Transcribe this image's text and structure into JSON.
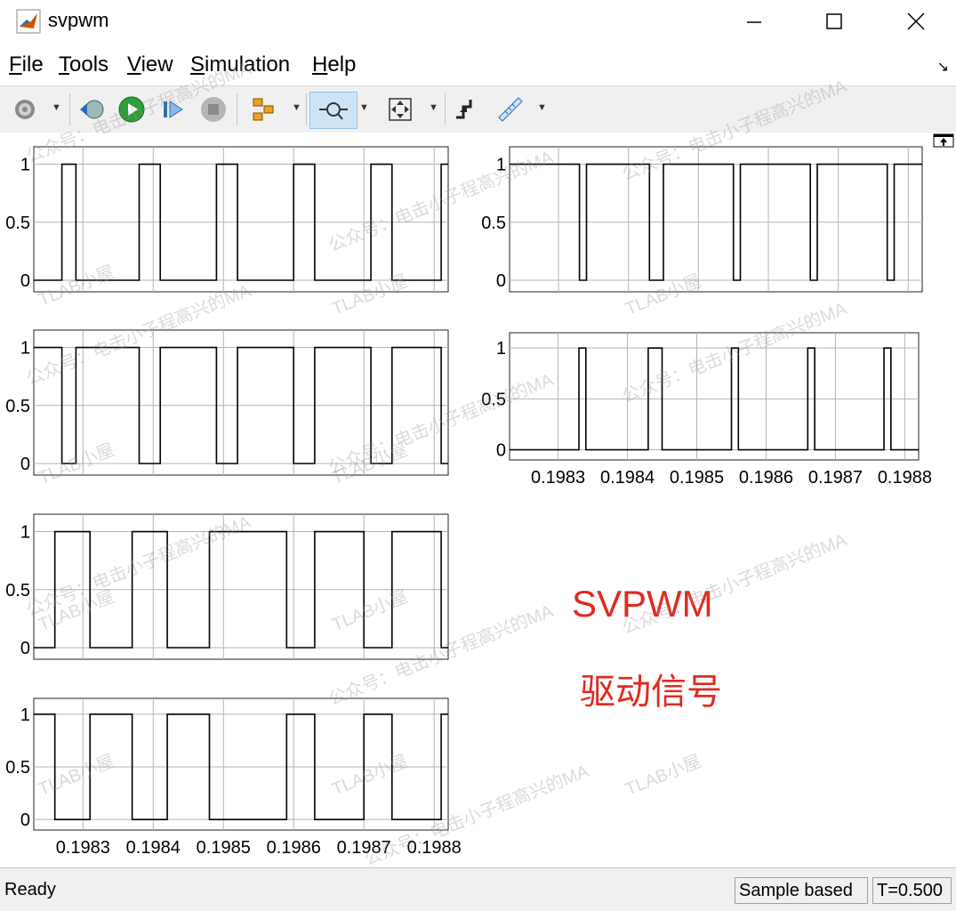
{
  "window": {
    "title": "svpwm"
  },
  "menu": [
    {
      "label": "File",
      "mnemonic": "F",
      "rest": "ile"
    },
    {
      "label": "Tools",
      "mnemonic": "T",
      "rest": "ools"
    },
    {
      "label": "View",
      "mnemonic": "V",
      "rest": "iew"
    },
    {
      "label": "Simulation",
      "mnemonic": "S",
      "rest": "imulation"
    },
    {
      "label": "Help",
      "mnemonic": "H",
      "rest": "elp"
    }
  ],
  "toolbar": [
    "settings-icon",
    "restore-icon",
    "run-icon",
    "step-forward-icon",
    "stop-icon",
    "highlight-icon",
    "zoom-icon",
    "fit-to-view-icon",
    "triggers-icon",
    "measure-icon"
  ],
  "annotation": {
    "title": "SVPWM",
    "subtitle": "驱动信号"
  },
  "watermark": {
    "line1": "公众号：电击小子程高兴的MA",
    "line2": "TLAB小屋"
  },
  "status": {
    "left": "Ready",
    "mode": "Sample based",
    "time": "T=0.500"
  },
  "colors": {
    "signal": "#000000",
    "grid": "#b4b4b4",
    "annotation": "#e02b20",
    "toolbar_bg": "#f0f0f0"
  },
  "chart_data": [
    {
      "type": "line",
      "title": "",
      "xlabel": "",
      "ylabel": "",
      "xlim": [
        0.19823,
        0.19882
      ],
      "ylim": [
        -0.1,
        1.15
      ],
      "xticks": [
        "0.1983",
        "0.1984",
        "0.1985",
        "0.1986",
        "0.1987",
        "0.1988"
      ],
      "yticks": [
        "0",
        "0.5",
        "1"
      ],
      "grid": true,
      "show_xtick_labels": false,
      "series": [
        {
          "x": [
            0.19823,
            0.19827,
            0.19827,
            0.19829,
            0.19829,
            0.19838,
            0.19838,
            0.19841,
            0.19841,
            0.19849,
            0.19849,
            0.19852,
            0.19852,
            0.1986,
            0.1986,
            0.19863,
            0.19863,
            0.19871,
            0.19871,
            0.19874,
            0.19874,
            0.19881,
            0.19881,
            0.19882
          ],
          "y": [
            0,
            0,
            1,
            1,
            0,
            0,
            1,
            1,
            0,
            0,
            1,
            1,
            0,
            0,
            1,
            1,
            0,
            0,
            1,
            1,
            0,
            0,
            1,
            1
          ]
        }
      ]
    },
    {
      "type": "line",
      "title": "",
      "xlabel": "",
      "ylabel": "",
      "xlim": [
        0.19823,
        0.19882
      ],
      "ylim": [
        -0.1,
        1.15
      ],
      "xticks": [
        "0.1983",
        "0.1984",
        "0.1985",
        "0.1986",
        "0.1987",
        "0.1988"
      ],
      "yticks": [
        "0",
        "0.5",
        "1"
      ],
      "grid": true,
      "show_xtick_labels": false,
      "series": [
        {
          "x": [
            0.19823,
            0.19833,
            0.19833,
            0.19834,
            0.19834,
            0.19843,
            0.19843,
            0.19845,
            0.19845,
            0.19855,
            0.19855,
            0.19856,
            0.19856,
            0.19866,
            0.19866,
            0.19867,
            0.19867,
            0.19877,
            0.19877,
            0.19878,
            0.19878,
            0.19882
          ],
          "y": [
            1,
            1,
            0,
            0,
            1,
            1,
            0,
            0,
            1,
            1,
            0,
            0,
            1,
            1,
            0,
            0,
            1,
            1,
            0,
            0,
            1,
            1
          ]
        }
      ]
    },
    {
      "type": "line",
      "title": "",
      "xlabel": "",
      "ylabel": "",
      "xlim": [
        0.19823,
        0.19882
      ],
      "ylim": [
        -0.1,
        1.15
      ],
      "xticks": [
        "0.1983",
        "0.1984",
        "0.1985",
        "0.1986",
        "0.1987",
        "0.1988"
      ],
      "yticks": [
        "0",
        "0.5",
        "1"
      ],
      "grid": true,
      "show_xtick_labels": false,
      "series": [
        {
          "x": [
            0.19823,
            0.19827,
            0.19827,
            0.19829,
            0.19829,
            0.19838,
            0.19838,
            0.19841,
            0.19841,
            0.19849,
            0.19849,
            0.19852,
            0.19852,
            0.1986,
            0.1986,
            0.19863,
            0.19863,
            0.19871,
            0.19871,
            0.19874,
            0.19874,
            0.19881,
            0.19881,
            0.19882
          ],
          "y": [
            1,
            1,
            0,
            0,
            1,
            1,
            0,
            0,
            1,
            1,
            0,
            0,
            1,
            1,
            0,
            0,
            1,
            1,
            0,
            0,
            1,
            1,
            0,
            0
          ]
        }
      ]
    },
    {
      "type": "line",
      "title": "",
      "xlabel": "",
      "ylabel": "",
      "xlim": [
        0.19823,
        0.19882
      ],
      "ylim": [
        -0.1,
        1.15
      ],
      "xticks": [
        "0.1983",
        "0.1984",
        "0.1985",
        "0.1986",
        "0.1987",
        "0.1988"
      ],
      "yticks": [
        "0",
        "0.5",
        "1"
      ],
      "grid": true,
      "show_xtick_labels": true,
      "series": [
        {
          "x": [
            0.19823,
            0.19833,
            0.19833,
            0.19834,
            0.19834,
            0.19843,
            0.19843,
            0.19845,
            0.19845,
            0.19855,
            0.19855,
            0.19856,
            0.19856,
            0.19866,
            0.19866,
            0.19867,
            0.19867,
            0.19877,
            0.19877,
            0.19878,
            0.19878,
            0.19882
          ],
          "y": [
            0,
            0,
            1,
            1,
            0,
            0,
            1,
            1,
            0,
            0,
            1,
            1,
            0,
            0,
            1,
            1,
            0,
            0,
            1,
            1,
            0,
            0
          ]
        }
      ]
    },
    {
      "type": "line",
      "title": "",
      "xlabel": "",
      "ylabel": "",
      "xlim": [
        0.19823,
        0.19882
      ],
      "ylim": [
        -0.1,
        1.15
      ],
      "xticks": [
        "0.1983",
        "0.1984",
        "0.1985",
        "0.1986",
        "0.1987",
        "0.1988"
      ],
      "yticks": [
        "0",
        "0.5",
        "1"
      ],
      "grid": true,
      "show_xtick_labels": false,
      "series": [
        {
          "x": [
            0.19823,
            0.19826,
            0.19826,
            0.19831,
            0.19831,
            0.19837,
            0.19837,
            0.19842,
            0.19842,
            0.19848,
            0.19848,
            0.19859,
            0.19859,
            0.19863,
            0.19863,
            0.1987,
            0.1987,
            0.19874,
            0.19874,
            0.19881,
            0.19881,
            0.19882
          ],
          "y": [
            0,
            0,
            1,
            1,
            0,
            0,
            1,
            1,
            0,
            0,
            1,
            1,
            0,
            0,
            1,
            1,
            0,
            0,
            1,
            1,
            0,
            0
          ]
        }
      ]
    },
    {
      "type": "line",
      "title": "",
      "xlabel": "",
      "ylabel": "",
      "xlim": [
        0.19823,
        0.19882
      ],
      "ylim": [
        -0.1,
        1.15
      ],
      "xticks": [
        "0.1983",
        "0.1984",
        "0.1985",
        "0.1986",
        "0.1987",
        "0.1988"
      ],
      "yticks": [
        "0",
        "0.5",
        "1"
      ],
      "grid": true,
      "show_xtick_labels": true,
      "series": [
        {
          "x": [
            0.19823,
            0.19826,
            0.19826,
            0.19831,
            0.19831,
            0.19837,
            0.19837,
            0.19842,
            0.19842,
            0.19848,
            0.19848,
            0.19859,
            0.19859,
            0.19863,
            0.19863,
            0.1987,
            0.1987,
            0.19874,
            0.19874,
            0.19881,
            0.19881,
            0.19882
          ],
          "y": [
            1,
            1,
            0,
            0,
            1,
            1,
            0,
            0,
            1,
            1,
            0,
            0,
            1,
            1,
            0,
            0,
            1,
            1,
            0,
            0,
            1,
            1
          ]
        }
      ]
    }
  ]
}
